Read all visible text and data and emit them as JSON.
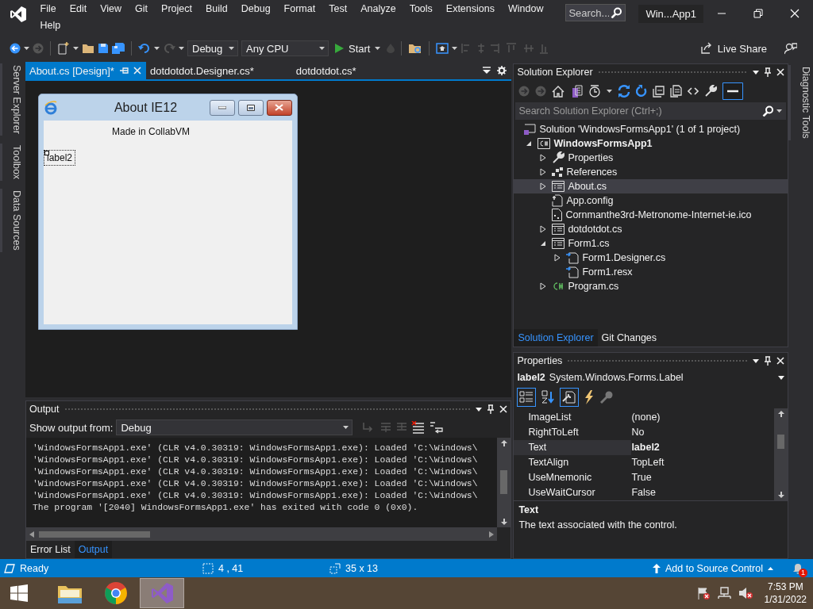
{
  "title_bar": {
    "menu": [
      "File",
      "Edit",
      "View",
      "Git",
      "Project",
      "Build",
      "Debug",
      "Format",
      "Test",
      "Analyze",
      "Tools",
      "Extensions",
      "Window",
      "Help"
    ],
    "search": {
      "placeholder": "Search..."
    },
    "title": "Win...App1"
  },
  "toolbar": {
    "configuration": "Debug",
    "platform": "Any CPU",
    "start": "Start",
    "live_share": "Live Share"
  },
  "left_tool_tabs": [
    "Server Explorer",
    "Toolbox",
    "Data Sources"
  ],
  "document_tabs": [
    {
      "label": "About.cs [Design]*",
      "selected": true
    },
    {
      "label": "dotdotdot.Designer.cs*",
      "selected": false
    },
    {
      "label": "dotdotdot.cs*",
      "selected": false
    }
  ],
  "designer": {
    "form_title": "About IE12",
    "controls": [
      {
        "text": "Made in CollabVM",
        "selected": false
      },
      {
        "text": "label2",
        "selected": true
      }
    ]
  },
  "output": {
    "title": "Output",
    "show_from_label": "Show output from:",
    "source": "Debug",
    "lines": [
      "'WindowsFormsApp1.exe' (CLR v4.0.30319: WindowsFormsApp1.exe): Loaded 'C:\\Windows\\",
      "'WindowsFormsApp1.exe' (CLR v4.0.30319: WindowsFormsApp1.exe): Loaded 'C:\\Windows\\",
      "'WindowsFormsApp1.exe' (CLR v4.0.30319: WindowsFormsApp1.exe): Loaded 'C:\\Windows\\",
      "'WindowsFormsApp1.exe' (CLR v4.0.30319: WindowsFormsApp1.exe): Loaded 'C:\\Windows\\",
      "'WindowsFormsApp1.exe' (CLR v4.0.30319: WindowsFormsApp1.exe): Loaded 'C:\\Windows\\",
      "The program '[2040] WindowsFormsApp1.exe' has exited with code 0 (0x0)."
    ],
    "tabs": [
      {
        "label": "Error List",
        "selected": false
      },
      {
        "label": "Output",
        "selected": true
      }
    ]
  },
  "solution_explorer": {
    "title": "Solution Explorer",
    "search": {
      "placeholder": "Search Solution Explorer (Ctrl+;)"
    },
    "tree": [
      {
        "label": "Solution 'WindowsFormsApp1' (1 of 1 project)",
        "kind": "solution",
        "selected": false,
        "children": [
          {
            "label": "WindowsFormsApp1",
            "kind": "project",
            "selected": false,
            "expanded": true,
            "children": [
              {
                "label": "Properties",
                "kind": "properties",
                "selected": false,
                "expanded": false
              },
              {
                "label": "References",
                "kind": "references",
                "selected": false,
                "expanded": false
              },
              {
                "label": "About.cs",
                "kind": "form",
                "selected": true,
                "expanded": false
              },
              {
                "label": "App.config",
                "kind": "config",
                "selected": false
              },
              {
                "label": "Cornmanthe3rd-Metronome-Internet-ie.ico",
                "kind": "image",
                "selected": false
              },
              {
                "label": "dotdotdot.cs",
                "kind": "form",
                "selected": false,
                "expanded": false
              },
              {
                "label": "Form1.cs",
                "kind": "form",
                "selected": false,
                "expanded": true,
                "children": [
                  {
                    "label": "Form1.Designer.cs",
                    "kind": "dependent",
                    "selected": false,
                    "expanded": false
                  },
                  {
                    "label": "Form1.resx",
                    "kind": "dependent",
                    "selected": false
                  }
                ]
              },
              {
                "label": "Program.cs",
                "kind": "csharp",
                "selected": false,
                "expanded": false
              }
            ]
          }
        ]
      }
    ],
    "tabs": [
      {
        "label": "Solution Explorer",
        "selected": true
      },
      {
        "label": "Git Changes",
        "selected": false
      }
    ]
  },
  "properties": {
    "title": "Properties",
    "object_name": "label2",
    "object_type": "System.Windows.Forms.Label",
    "rows": [
      {
        "name": "ImageList",
        "value": "(none)",
        "selected": false,
        "modified": false
      },
      {
        "name": "RightToLeft",
        "value": "No",
        "selected": false,
        "modified": false
      },
      {
        "name": "Text",
        "value": "label2",
        "selected": true,
        "modified": true
      },
      {
        "name": "TextAlign",
        "value": "TopLeft",
        "selected": false,
        "modified": false
      },
      {
        "name": "UseMnemonic",
        "value": "True",
        "selected": false,
        "modified": false
      },
      {
        "name": "UseWaitCursor",
        "value": "False",
        "selected": false,
        "modified": false
      }
    ],
    "description": {
      "title": "Text",
      "text": "The text associated with the control."
    }
  },
  "right_tool_tabs": [
    "Diagnostic Tools"
  ],
  "status_bar": {
    "ready": "Ready",
    "position": "4 , 41",
    "size": "35 x 13",
    "source_control": "Add to Source Control",
    "notifications": "1"
  },
  "taskbar": {
    "apps": [
      {
        "kind": "explorer",
        "selected": false
      },
      {
        "kind": "chrome",
        "selected": false
      },
      {
        "kind": "vs",
        "selected": true
      }
    ],
    "time": "7:53 PM",
    "date": "1/31/2022"
  }
}
